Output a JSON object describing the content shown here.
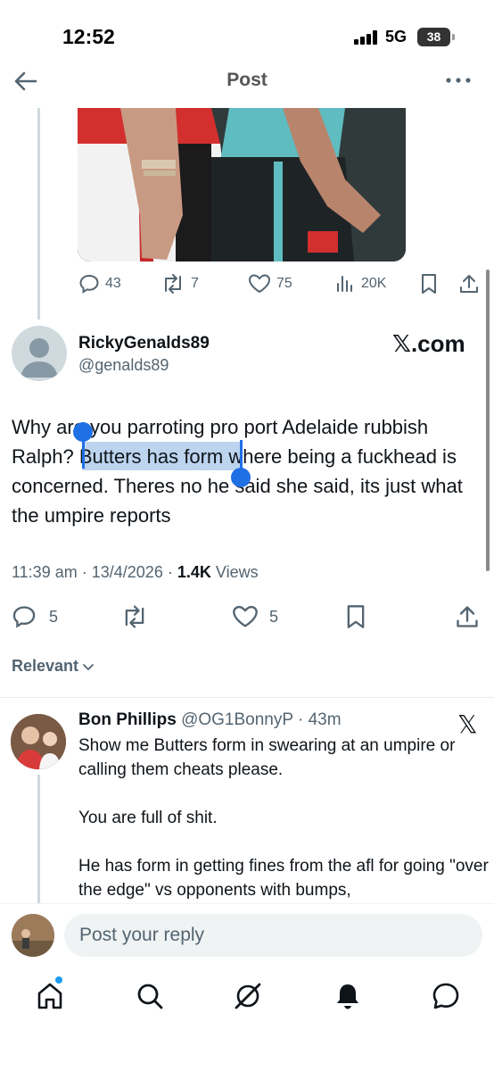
{
  "status_bar": {
    "time": "12:52",
    "network": "5G",
    "battery": "38"
  },
  "header": {
    "title": "Post"
  },
  "parent_tweet": {
    "stats": {
      "replies": "43",
      "reposts": "7",
      "likes": "75",
      "views": "20K"
    }
  },
  "main_tweet": {
    "author_name": "RickyGenalds89",
    "author_handle": "@genalds89",
    "badge_text": ".com",
    "text": "Why are you parroting pro port Adelaide rubbish Ralph? Butters has form where being a fuckhead is concerned. Theres no he said she said, its just what the umpire reports",
    "selected_text": "Butters has form",
    "time": "11:39 am",
    "date": "13/4/2026",
    "views_count": "1.4K",
    "views_label": "Views",
    "stats": {
      "replies": "5",
      "likes": "5"
    }
  },
  "filter": {
    "label": "Relevant"
  },
  "reply": {
    "author_name": "Bon Phillips",
    "author_handle": "@OG1BonnyP",
    "time": "43m",
    "paragraphs": [
      "Show me Butters form in swearing at an umpire or calling them cheats please.",
      "You are full of shit.",
      "He has form in getting fines from the afl for going \"over the edge\" vs opponents with bumps,"
    ]
  },
  "composer": {
    "placeholder": "Post your reply"
  },
  "colors": {
    "accent": "#1d9bf0",
    "selection": "#bcd4ee",
    "secondary_text": "#536471"
  },
  "icons": {
    "back": "arrow-left-icon",
    "more": "more-icon",
    "reply": "reply-icon",
    "repost": "repost-icon",
    "like": "heart-icon",
    "views": "views-icon",
    "bookmark": "bookmark-icon",
    "share": "share-icon",
    "home": "home-icon",
    "search": "search-icon",
    "grok": "grok-icon",
    "notifications": "bell-icon",
    "messages": "messages-icon"
  }
}
